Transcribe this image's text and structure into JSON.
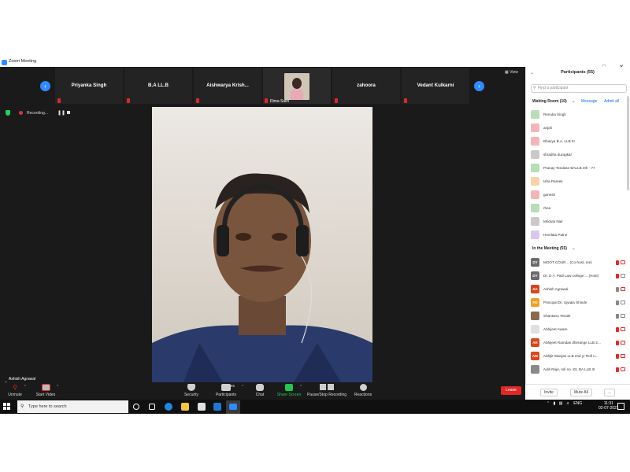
{
  "window": {
    "title": "Zoom Meeting"
  },
  "gallery": {
    "tiles": [
      "Priyanka Singh",
      "B.A LL.B",
      "Aishwarya Krish...",
      "Rima Saini",
      "zahoora",
      "Vedant Kulkarni"
    ]
  },
  "meeting": {
    "view_label": "View",
    "recording_label": "Recording...",
    "speaker_name": "Ashish Agrawal"
  },
  "toolbar": {
    "unmute": "Unmute",
    "start_video": "Start Video",
    "security": "Security",
    "participants": "Participants",
    "participants_count": "65",
    "chat": "Chat",
    "share_screen": "Share Screen",
    "record": "Pause/Stop Recording",
    "reactions": "Reactions",
    "leave": "Leave"
  },
  "panel": {
    "title": "Participants (55)",
    "search_placeholder": "Find a participant",
    "waiting_header": "Waiting Room (10)",
    "message": "Message",
    "admit_all": "Admit all",
    "waiting": [
      {
        "name": "Renuka Singh",
        "initials": "",
        "color": "#b9ddb6"
      },
      {
        "name": "anjali",
        "initials": "",
        "color": "#f3b6b6"
      },
      {
        "name": "Bhavya B.A. LLB III",
        "initials": "",
        "color": "#f3b6b6"
      },
      {
        "name": "shradha duragkar",
        "initials": "",
        "color": "#c9c9c9"
      },
      {
        "name": "Pranay Tondase BALLB 4th - 77",
        "initials": "",
        "color": "#b9ddb6"
      },
      {
        "name": "Isha Pareek",
        "initials": "",
        "color": "#f8d3a8"
      },
      {
        "name": "ganesh",
        "initials": "",
        "color": "#f3b6b6"
      },
      {
        "name": "rhea",
        "initials": "",
        "color": "#b9ddb6"
      },
      {
        "name": "Mridula Nair",
        "initials": "",
        "color": "#c9c9c9"
      },
      {
        "name": "Hemlata Patne",
        "initials": "",
        "color": "#d8c8ef"
      }
    ],
    "inmeeting_header": "In the Meeting (55)",
    "inmeeting": [
      {
        "name": "MOOT COUR... (Co-host, me)",
        "initials": "DY",
        "color": "#6b6b6b"
      },
      {
        "name": "Dr. D.Y. Patil Law college ... (Host)",
        "initials": "DY",
        "color": "#6b6b6b"
      },
      {
        "name": "Ashish Agrawal",
        "initials": "AA",
        "color": "#d9471c"
      },
      {
        "name": "Principal Dr. Ujwala Shinde",
        "initials": "PD",
        "color": "#f0a020"
      },
      {
        "name": "Shantanu Yevale",
        "initials": "",
        "color": "#8a6a50"
      },
      {
        "name": "Abhijeet Aware",
        "initials": "",
        "color": "#e0e0e0"
      },
      {
        "name": "Abhijeet Ramdas dherange LLB 2...",
        "initials": "AR",
        "color": "#d9471c"
      },
      {
        "name": "Abhijit Wanjari LLB 2nd yr Roll n...",
        "initials": "AW",
        "color": "#d9471c"
      },
      {
        "name": "Aditi Raje, roll no. 83, BA LLB III",
        "initials": "",
        "color": "#8a8a8a"
      }
    ],
    "invite": "Invite",
    "mute_all": "Mute All",
    "more": "..."
  },
  "taskbar": {
    "search_placeholder": "Type here to search",
    "lang": "ENG",
    "time": "11:31",
    "date": "02-07-2021"
  }
}
